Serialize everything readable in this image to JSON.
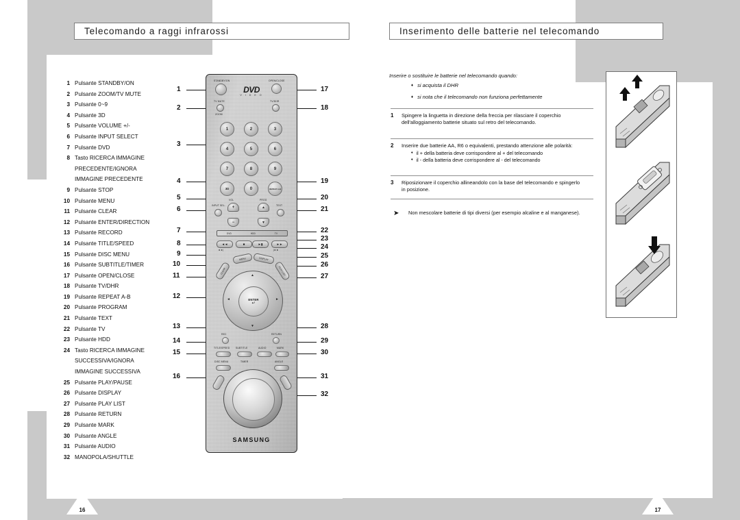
{
  "headers": {
    "left": "Telecomando a raggi infrarossi",
    "right": "Inserimento delle batterie nel telecomando"
  },
  "button_list": [
    {
      "num": "1",
      "label": "Pulsante STANDBY/ON"
    },
    {
      "num": "2",
      "label": "Pulsante ZOOM/TV MUTE"
    },
    {
      "num": "3",
      "label": "Pulsante 0~9"
    },
    {
      "num": "4",
      "label": "Pulsante 3D"
    },
    {
      "num": "5",
      "label": "Pulsante VOLUME +/-"
    },
    {
      "num": "6",
      "label": "Pulsante INPUT SELECT"
    },
    {
      "num": "7",
      "label": "Pulsante DVD"
    },
    {
      "num": "8",
      "label": "Tasto RICERCA IMMAGINE"
    },
    {
      "num": "",
      "label": "PRECEDENTE/IGNORA"
    },
    {
      "num": "",
      "label": "IMMAGINE PRECEDENTE"
    },
    {
      "num": "9",
      "label": "Pulsante STOP"
    },
    {
      "num": "10",
      "label": "Pulsante MENU"
    },
    {
      "num": "11",
      "label": "Pulsante CLEAR"
    },
    {
      "num": "12",
      "label": "Pulsante ENTER/DIRECTION"
    },
    {
      "num": "13",
      "label": "Pulsante RECORD"
    },
    {
      "num": "14",
      "label": "Pulsante TITLE/SPEED"
    },
    {
      "num": "15",
      "label": "Pulsante DISC MENU"
    },
    {
      "num": "16",
      "label": "Pulsante SUBTITLE/TIMER"
    },
    {
      "num": "17",
      "label": "Pulsante OPEN/CLOSE"
    },
    {
      "num": "18",
      "label": "Pulsante TV/DHR"
    },
    {
      "num": "19",
      "label": "Pulsante REPEAT A-B"
    },
    {
      "num": "20",
      "label": "Pulsante PROGRAM"
    },
    {
      "num": "21",
      "label": "Pulsante TEXT"
    },
    {
      "num": "22",
      "label": "Pulsante TV"
    },
    {
      "num": "23",
      "label": "Pulsante HDD"
    },
    {
      "num": "24",
      "label": "Tasto RICERCA IMMAGINE"
    },
    {
      "num": "",
      "label": "SUCCESSIVA/IGNORA"
    },
    {
      "num": "",
      "label": "IMMAGINE SUCCESSIVA"
    },
    {
      "num": "25",
      "label": "Pulsante PLAY/PAUSE"
    },
    {
      "num": "26",
      "label": "Pulsante DISPLAY"
    },
    {
      "num": "27",
      "label": "Pulsante PLAY LIST"
    },
    {
      "num": "28",
      "label": "Pulsante RETURN"
    },
    {
      "num": "29",
      "label": "Pulsante MARK"
    },
    {
      "num": "30",
      "label": "Pulsante ANGLE"
    },
    {
      "num": "31",
      "label": "Pulsante AUDIO"
    },
    {
      "num": "32",
      "label": "MANOPOLA/SHUTTLE"
    }
  ],
  "callouts_left": [
    "1",
    "2",
    "3",
    "4",
    "5",
    "6",
    "7",
    "8",
    "9",
    "10",
    "11",
    "12",
    "13",
    "14",
    "15",
    "16"
  ],
  "callouts_right": [
    "17",
    "18",
    "19",
    "20",
    "21",
    "22",
    "23",
    "24",
    "25",
    "26",
    "27",
    "28",
    "29",
    "30",
    "31",
    "32"
  ],
  "remote": {
    "brand": "SAMSUNG",
    "logo_main": "DVD",
    "logo_sub": "V I D E O",
    "labels": {
      "standby": "STANDBY/ON",
      "open_close": "OPEN/CLOSE",
      "tv_mute": "TV MUTE",
      "zoom": "ZOOM",
      "tv_dhr": "TV/DHR",
      "vol": "VOL",
      "prog": "PROG",
      "input_sel": "INPUT SEL.",
      "text": "TEXT",
      "rec": "REC",
      "return": "RETURN",
      "enter": "ENTER",
      "enter_glyph": "↵",
      "title_speed": "TITLE/SPEED",
      "subtitle": "SUBTITLE",
      "audio": "AUDIO",
      "mark": "MARK",
      "disc_menu": "DISC MENU",
      "timer": "TIMER",
      "angle": "ANGLE",
      "menu": "MENU",
      "display": "DISPLAY",
      "clear": "CLEAR",
      "play_list": "PLAY LIST",
      "plus": "+",
      "minus": "−",
      "up": "▲",
      "down": "▼",
      "rew": "◄◄",
      "stop": "■",
      "play": "►▮",
      "ff": "►►",
      "skip_prev": "◄◄|",
      "skip_next": "|►►",
      "repeat_ab": "REPEAT A-B",
      "threeD": "3D",
      "program": "PROGRAM",
      "hdd": "HDD",
      "dvd": "DVD",
      "tv": "TV"
    },
    "strip_items": [
      "DVD",
      "HDD",
      "TV"
    ],
    "keypad": [
      "1",
      "2",
      "3",
      "4",
      "5",
      "6",
      "7",
      "8",
      "9",
      "3D",
      "0",
      "REPEAT A-B"
    ]
  },
  "right_page": {
    "intro": "Inserire o sostituire le batterie nel telecomando quando:",
    "bullets": [
      "si acquista il DHR",
      "si nota che il telecomando non funziona perfettamente"
    ],
    "steps": [
      {
        "num": "1",
        "text": "Spingere la linguetta in direzione della freccia per rilasciare il coperchio dell'alloggiamento batterie situato sul retro del telecomando.",
        "sub": []
      },
      {
        "num": "2",
        "text": "Inserire due batterie AA, R6 o equivalenti, prestando attenzione alle polarità:",
        "sub": [
          "il + della batteria deve corrispondere al + del telecomando",
          "il - della batteria deve corrispondere al - del telecomando"
        ]
      },
      {
        "num": "3",
        "text": "Riposizionare il coperchio allineandolo con la base del telecomando e spingerlo in posizione.",
        "sub": []
      }
    ],
    "note": "Non mescolare batterie di tipi diversi (per esempio alcaline e al manganese).",
    "note_arrow": "➤",
    "bullet_glyph": "♦"
  },
  "page_numbers": {
    "left": "16",
    "right": "17"
  },
  "colors": {
    "gray_block": "#c9c9c9",
    "rule": "#8e8e8e",
    "border": "#7d7d7d",
    "text": "#111111"
  }
}
